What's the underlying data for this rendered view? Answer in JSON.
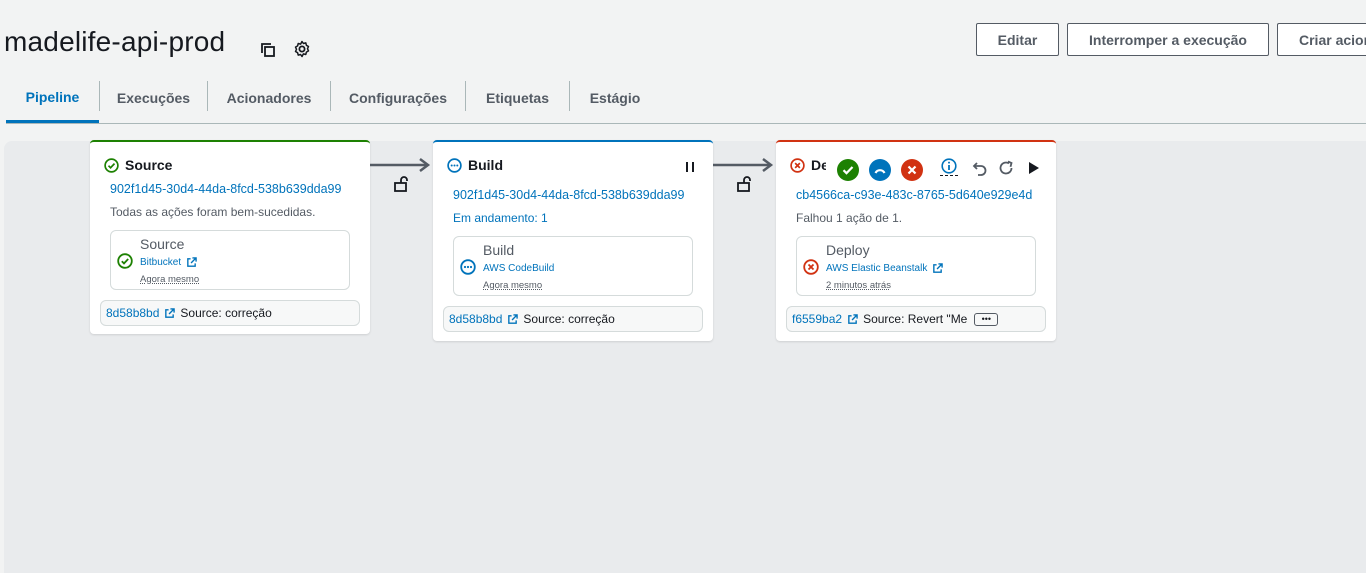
{
  "header": {
    "title": "madelife-api-prod",
    "buttons": {
      "edit": "Editar",
      "stop": "Interromper a execução",
      "create": "Criar acionador"
    }
  },
  "tabs": [
    {
      "label": "Pipeline",
      "active": true
    },
    {
      "label": "Execuções"
    },
    {
      "label": "Acionadores"
    },
    {
      "label": "Configurações"
    },
    {
      "label": "Etiquetas"
    },
    {
      "label": "Estágio"
    }
  ],
  "stages": [
    {
      "name": "Source",
      "status": "succeeded",
      "execution_id": "902f1d45-30d4-44da-8fcd-538b639dda99",
      "status_text": "Todas as ações foram bem-sucedidas.",
      "action": {
        "name": "Source",
        "provider": "Bitbucket",
        "time": "Agora mesmo",
        "status": "succeeded"
      },
      "revision": {
        "id": "8d58b8bd",
        "message": "Source: correção"
      }
    },
    {
      "name": "Build",
      "status": "in-progress",
      "execution_id": "902f1d45-30d4-44da-8fcd-538b639dda99",
      "status_text": "Em andamento: 1",
      "action": {
        "name": "Build",
        "provider": "AWS CodeBuild",
        "time": "Agora mesmo",
        "status": "in-progress"
      },
      "revision": {
        "id": "8d58b8bd",
        "message": "Source: correção"
      }
    },
    {
      "name": "De",
      "status": "failed",
      "execution_id": "cb4566ca-c93e-483c-8765-5d640e929e4d",
      "status_text": "Falhou 1 ação de 1.",
      "action": {
        "name": "Deploy",
        "provider": "AWS Elastic Beanstalk",
        "time": "2 minutos atrás",
        "status": "failed"
      },
      "revision": {
        "id": "f6559ba2",
        "message": "Source: Revert \"Me",
        "more": "•••"
      }
    }
  ],
  "icons": {
    "copy": "copy-icon",
    "settings": "gear-icon",
    "pause": "pause-icon",
    "external": "external-link-icon",
    "lock": "unlocked-transition-icon"
  },
  "colors": {
    "success": "#1d8102",
    "failed": "#d13212",
    "in_progress": "#0073bb",
    "link": "#0073bb"
  }
}
